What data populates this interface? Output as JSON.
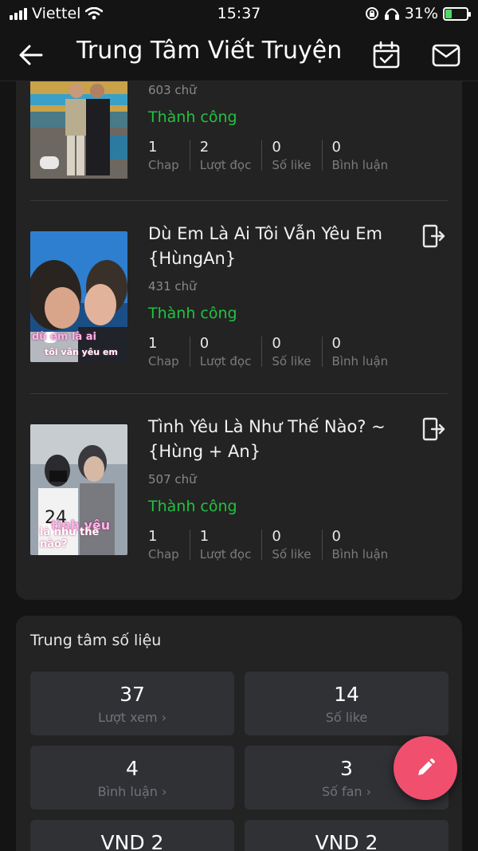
{
  "status_bar": {
    "carrier": "Viettel",
    "time": "15:37",
    "battery": "31%",
    "battery_level": 0.31
  },
  "header": {
    "title": "Trung Tâm Viết Truyện",
    "back_icon": "back-arrow-icon",
    "calendar_icon": "calendar-check-icon",
    "mail_icon": "mail-icon"
  },
  "stories": [
    {
      "title": "",
      "word_count": "603 chữ",
      "status": "Thành công",
      "stats": [
        {
          "value": "1",
          "label": "Chap"
        },
        {
          "value": "2",
          "label": "Lượt đọc"
        },
        {
          "value": "0",
          "label": "Số like"
        },
        {
          "value": "0",
          "label": "Bình luận"
        }
      ]
    },
    {
      "title": "Dù Em Là Ai Tôi Vẫn Yêu Em {HùngAn}",
      "word_count": "431 chữ",
      "status": "Thành công",
      "cover_text": "dù em là ai",
      "cover_subtext": "tôi vẫn yêu em",
      "stats": [
        {
          "value": "1",
          "label": "Chap"
        },
        {
          "value": "0",
          "label": "Lượt đọc"
        },
        {
          "value": "0",
          "label": "Số like"
        },
        {
          "value": "0",
          "label": "Bình luận"
        }
      ]
    },
    {
      "title": "Tình Yêu Là Như Thế Nào? ~{Hùng + An}",
      "word_count": "507 chữ",
      "status": "Thành công",
      "cover_text": "tình yêu",
      "cover_subtext": "là như thế nào?",
      "stats": [
        {
          "value": "1",
          "label": "Chap"
        },
        {
          "value": "1",
          "label": "Lượt đọc"
        },
        {
          "value": "0",
          "label": "Số like"
        },
        {
          "value": "0",
          "label": "Bình luận"
        }
      ]
    }
  ],
  "data_center": {
    "title": "Trung tâm số liệu",
    "tiles": [
      {
        "value": "37",
        "label": "Lượt xem",
        "has_arrow": true
      },
      {
        "value": "14",
        "label": "Số like",
        "has_arrow": false
      },
      {
        "value": "4",
        "label": "Bình luận",
        "has_arrow": true
      },
      {
        "value": "3",
        "label": "Số fan",
        "has_arrow": true
      },
      {
        "value": "VND 2",
        "label": ""
      },
      {
        "value": "VND 2",
        "label": ""
      }
    ]
  },
  "fab": {
    "icon": "pencil-icon"
  },
  "colors": {
    "background": "#141414",
    "card": "#232323",
    "tile": "#2f3135",
    "success": "#21c23f",
    "fab": "#f0506e"
  }
}
